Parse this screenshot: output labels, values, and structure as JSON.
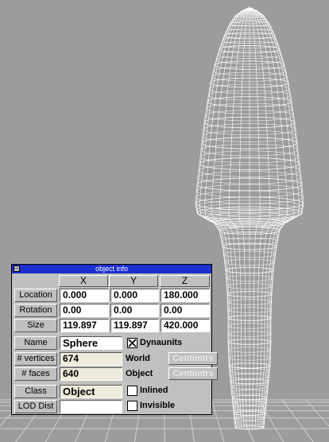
{
  "panel": {
    "title": "object info",
    "columns": [
      "X",
      "Y",
      "Z"
    ],
    "rows": [
      {
        "label": "Location",
        "values": [
          "0.000",
          "0.000",
          "180.000"
        ]
      },
      {
        "label": "Rotation",
        "values": [
          "0.00",
          "0.00",
          "0.00"
        ]
      },
      {
        "label": "Size",
        "values": [
          "119.897",
          "119.897",
          "420.000"
        ]
      }
    ],
    "name_label": "Name",
    "name_value": "Sphere",
    "vertices_label": "# vertices",
    "vertices_value": "674",
    "faces_label": "# faces",
    "faces_value": "640",
    "class_label": "Class",
    "class_value": "Object",
    "lod_label": "LOD Dist",
    "lod_value": "",
    "dynaunits_label": "Dynaunits",
    "dynaunits_checked": true,
    "world_label": "World",
    "world_unit": "Centimtrs",
    "object_label": "Object",
    "object_unit": "Centimtrs",
    "inlined_label": "Inlined",
    "inlined_checked": false,
    "invisible_label": "Invisible",
    "invisible_checked": false
  },
  "colors": {
    "background": "#9c9c9c",
    "grid": "#cfcfcf",
    "wireframe": "#ffffff",
    "titlebar": "#1c2fd0",
    "panel": "#c0c0c0",
    "readonly_field": "#efebdc"
  }
}
